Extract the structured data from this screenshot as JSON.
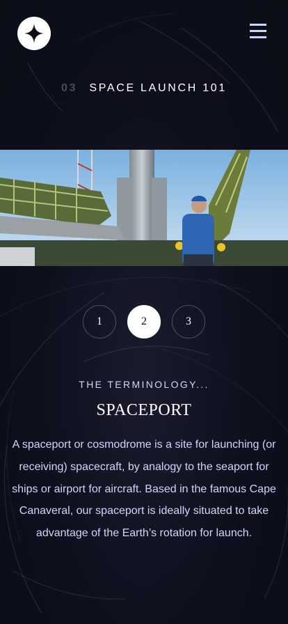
{
  "header": {
    "logo_icon": "star-logo-icon",
    "menu_icon": "hamburger-menu-icon"
  },
  "page": {
    "number": "03",
    "title": "SPACE LAUNCH 101"
  },
  "hero": {
    "image_description_icon": "launch-pad-image"
  },
  "pager": {
    "items": [
      "1",
      "2",
      "3"
    ],
    "active_index": 1
  },
  "content": {
    "eyebrow": "THE TERMINOLOGY...",
    "name": "SPACEPORT",
    "description": "A spaceport or cosmodrome is a site for launching (or receiving) spacecraft, by analogy to the seaport for ships or airport for aircraft. Based in the famous Cape Canaveral, our spaceport is ideally situated to take advantage of the Earth’s rotation for launch."
  },
  "colors": {
    "background": "#0b0d17",
    "accent_text": "#d0d6f9",
    "white": "#ffffff"
  }
}
